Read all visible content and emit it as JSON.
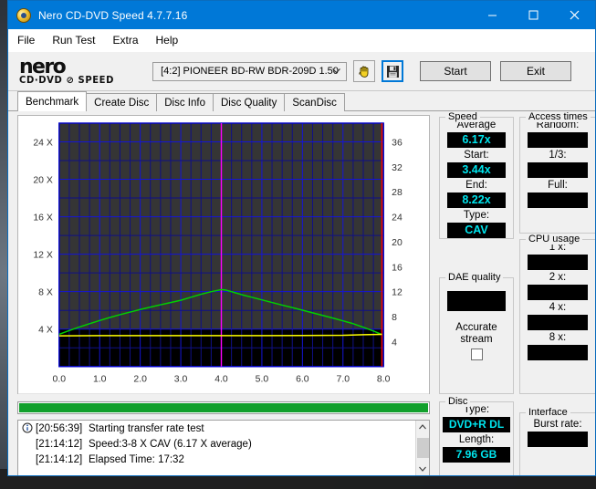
{
  "window": {
    "title": "Nero CD-DVD Speed 4.7.7.16",
    "minimize": "─",
    "maximize": "☐",
    "close": "✕",
    "titlebar_color": "#0078d7"
  },
  "menu": [
    "File",
    "Run Test",
    "Extra",
    "Help"
  ],
  "logo": {
    "line1": "nero",
    "line2": "CD·DVD ⊘ SPEED"
  },
  "toolbar": {
    "drive": "[4:2]  PIONEER BD-RW  BDR-209D 1.50",
    "caret": "⌄",
    "start_label": "Start",
    "exit_label": "Exit"
  },
  "tabs": [
    {
      "label": "Benchmark",
      "active": true
    },
    {
      "label": "Create Disc",
      "active": false
    },
    {
      "label": "Disc Info",
      "active": false
    },
    {
      "label": "Disc Quality",
      "active": false
    },
    {
      "label": "ScanDisc",
      "active": false
    }
  ],
  "chart_data": {
    "type": "line",
    "title": "",
    "xlabel": "",
    "ylabel": "",
    "xlim": [
      0.0,
      8.0
    ],
    "ylim": [
      0,
      26
    ],
    "y2lim": [
      0,
      39
    ],
    "grid": true,
    "legend": "none",
    "background": "#2e2e2e",
    "plot_background": "#000000",
    "grid_color": "#0000cd",
    "xticks": [
      "0.0",
      "1.0",
      "2.0",
      "3.0",
      "4.0",
      "5.0",
      "6.0",
      "7.0",
      "8.0"
    ],
    "yticks": [
      "4 X",
      "8 X",
      "12 X",
      "16 X",
      "20 X",
      "24 X"
    ],
    "ytick_values": [
      4,
      8,
      12,
      16,
      20,
      24
    ],
    "y2ticks": [
      "4",
      "8",
      "12",
      "16",
      "20",
      "24",
      "28",
      "32",
      "36"
    ],
    "y2tick_values": [
      4,
      8,
      12,
      16,
      20,
      24,
      28,
      32,
      36
    ],
    "markers": [
      {
        "x": 4.0,
        "color": "#ff00ff",
        "label": "position marker"
      },
      {
        "x": 7.96,
        "color": "#ff0000",
        "label": "disc end"
      }
    ],
    "series": [
      {
        "name": "Transfer rate",
        "color": "#00d000",
        "x": [
          0.0,
          0.25,
          0.5,
          0.75,
          1.0,
          1.25,
          1.5,
          1.75,
          2.0,
          2.25,
          2.5,
          2.75,
          3.0,
          3.25,
          3.5,
          3.75,
          4.0,
          4.1,
          4.25,
          4.5,
          4.75,
          5.0,
          5.25,
          5.5,
          5.75,
          6.0,
          6.25,
          6.5,
          6.75,
          7.0,
          7.25,
          7.5,
          7.75,
          7.96
        ],
        "values": [
          3.44,
          3.85,
          4.22,
          4.58,
          4.92,
          5.24,
          5.54,
          5.82,
          6.09,
          6.35,
          6.6,
          6.84,
          7.08,
          7.4,
          7.72,
          8.0,
          8.22,
          8.18,
          8.0,
          7.68,
          7.4,
          7.12,
          6.84,
          6.56,
          6.3,
          6.02,
          5.74,
          5.46,
          5.18,
          4.88,
          4.58,
          4.2,
          3.8,
          3.42
        ]
      },
      {
        "name": "Spindle speed",
        "color": "#ffff00",
        "x": [
          0.0,
          1.0,
          2.0,
          3.0,
          4.0,
          5.0,
          6.0,
          7.0,
          7.5,
          7.96
        ],
        "values": [
          3.28,
          3.3,
          3.3,
          3.3,
          3.3,
          3.3,
          3.32,
          3.34,
          3.4,
          3.44
        ]
      }
    ]
  },
  "panels": {
    "speed": {
      "title": "Speed",
      "fields": [
        {
          "label": "Average",
          "value": "6.17x"
        },
        {
          "label": "Start:",
          "value": "3.44x"
        },
        {
          "label": "End:",
          "value": "8.22x"
        },
        {
          "label": "Type:",
          "value": "CAV"
        }
      ]
    },
    "dae": {
      "title": "DAE quality",
      "value": "",
      "checkbox_label_line1": "Accurate",
      "checkbox_label_line2": "stream",
      "checked": false
    },
    "access": {
      "title": "Access times",
      "fields": [
        {
          "label": "Random:",
          "value": ""
        },
        {
          "label": "1/3:",
          "value": ""
        },
        {
          "label": "Full:",
          "value": ""
        }
      ]
    },
    "cpu": {
      "title": "CPU usage",
      "fields": [
        {
          "label": "1 x:",
          "value": ""
        },
        {
          "label": "2 x:",
          "value": ""
        },
        {
          "label": "4 x:",
          "value": ""
        },
        {
          "label": "8 x:",
          "value": ""
        }
      ]
    },
    "disc": {
      "title": "Disc",
      "fields": [
        {
          "label": "Type:",
          "value": "DVD+R DL"
        },
        {
          "label": "Length:",
          "value": "7.96 GB"
        }
      ]
    },
    "interface": {
      "title": "Interface",
      "fields": [
        {
          "label": "Burst rate:",
          "value": ""
        }
      ]
    }
  },
  "progress": {
    "percent": 100,
    "color": "#12a02c"
  },
  "log": {
    "rows": [
      {
        "icon": "info-icon",
        "time": "[20:56:39]",
        "text": "Starting transfer rate test"
      },
      {
        "icon": "",
        "time": "[21:14:12]",
        "text": "Speed:3-8 X CAV (6.17 X average)"
      },
      {
        "icon": "",
        "time": "[21:14:12]",
        "text": "Elapsed Time: 17:32"
      }
    ],
    "scroll_up": "∧",
    "scroll_down": "∨"
  }
}
